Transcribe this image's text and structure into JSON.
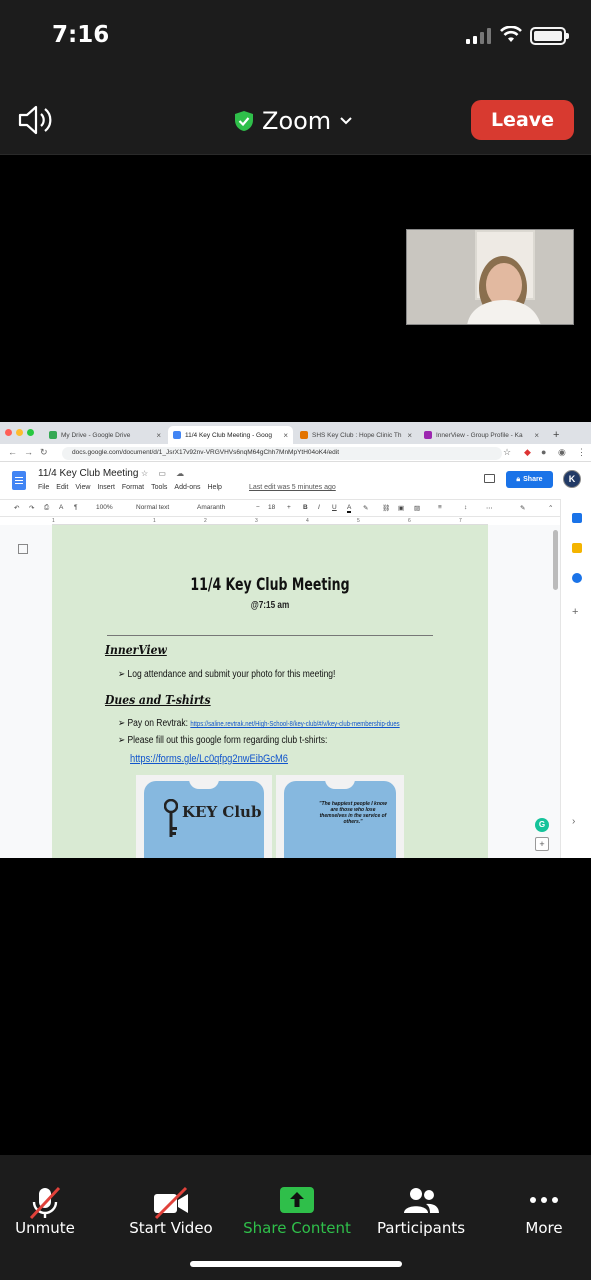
{
  "status_bar": {
    "time": "7:16"
  },
  "header": {
    "title": "Zoom",
    "leave_label": "Leave"
  },
  "browser": {
    "tabs": [
      {
        "label": "My Drive - Google Drive",
        "color": "#34a853"
      },
      {
        "label": "11/4 Key Club Meeting - Goog",
        "color": "#4285f4"
      },
      {
        "label": "SHS Key Club : Hope Clinic Th",
        "color": "#e37400"
      },
      {
        "label": "InnerView - Group Profile - Ka",
        "color": "#9c27b0"
      }
    ],
    "url": "docs.google.com/document/d/1_JsrX17v92nv-VRGVHVs6nqM64gChh7MnMpYtH04oK4/edit"
  },
  "docs": {
    "title": "11/4 Key Club Meeting",
    "menu": [
      "File",
      "Edit",
      "View",
      "Insert",
      "Format",
      "Tools",
      "Add-ons",
      "Help"
    ],
    "last_edit": "Last edit was 5 minutes ago",
    "share_label": "Share",
    "avatar_letter": "K",
    "toolbar": {
      "zoom": "100%",
      "style": "Normal text",
      "font": "Amaranth",
      "size": "18"
    },
    "ruler_ticks": [
      "1",
      "1",
      "2",
      "3",
      "4",
      "5",
      "6",
      "7"
    ]
  },
  "document": {
    "heading": "11/4 Key Club Meeting",
    "subheading": "@7:15 am",
    "section1_title": "InnerView",
    "section1_bullet": "➢ Log attendance and submit your photo for this meeting!",
    "section2_title": "Dues and T-shirts",
    "bullet_pay_prefix": "➢ Pay on Revtrak: ",
    "bullet_pay_link": "https://saline.revtrak.net/High-School-8/key-club/#/v/key-club-membership-dues",
    "bullet_form": "➢ Please fill out this google form regarding club t-shirts:",
    "form_link": "https://forms.gle/Lc0qfpg2nwEibGcM6",
    "shirt_front_text": "KEY Club",
    "shirt_back_quote": "\"The happiest people I know are those who lose themselves in the service of others.\""
  },
  "controls": [
    {
      "label": "Unmute",
      "icon": "muted-mic-icon"
    },
    {
      "label": "Start Video",
      "icon": "video-off-icon"
    },
    {
      "label": "Share Content",
      "icon": "share-arrow-icon"
    },
    {
      "label": "Participants",
      "icon": "participants-icon"
    },
    {
      "label": "More",
      "icon": "more-dots-icon"
    }
  ],
  "colors": {
    "leave": "#d83a30",
    "share_green": "#2fbf4a",
    "page_bg": "#d9ead3",
    "mute_red": "#e0413a"
  }
}
